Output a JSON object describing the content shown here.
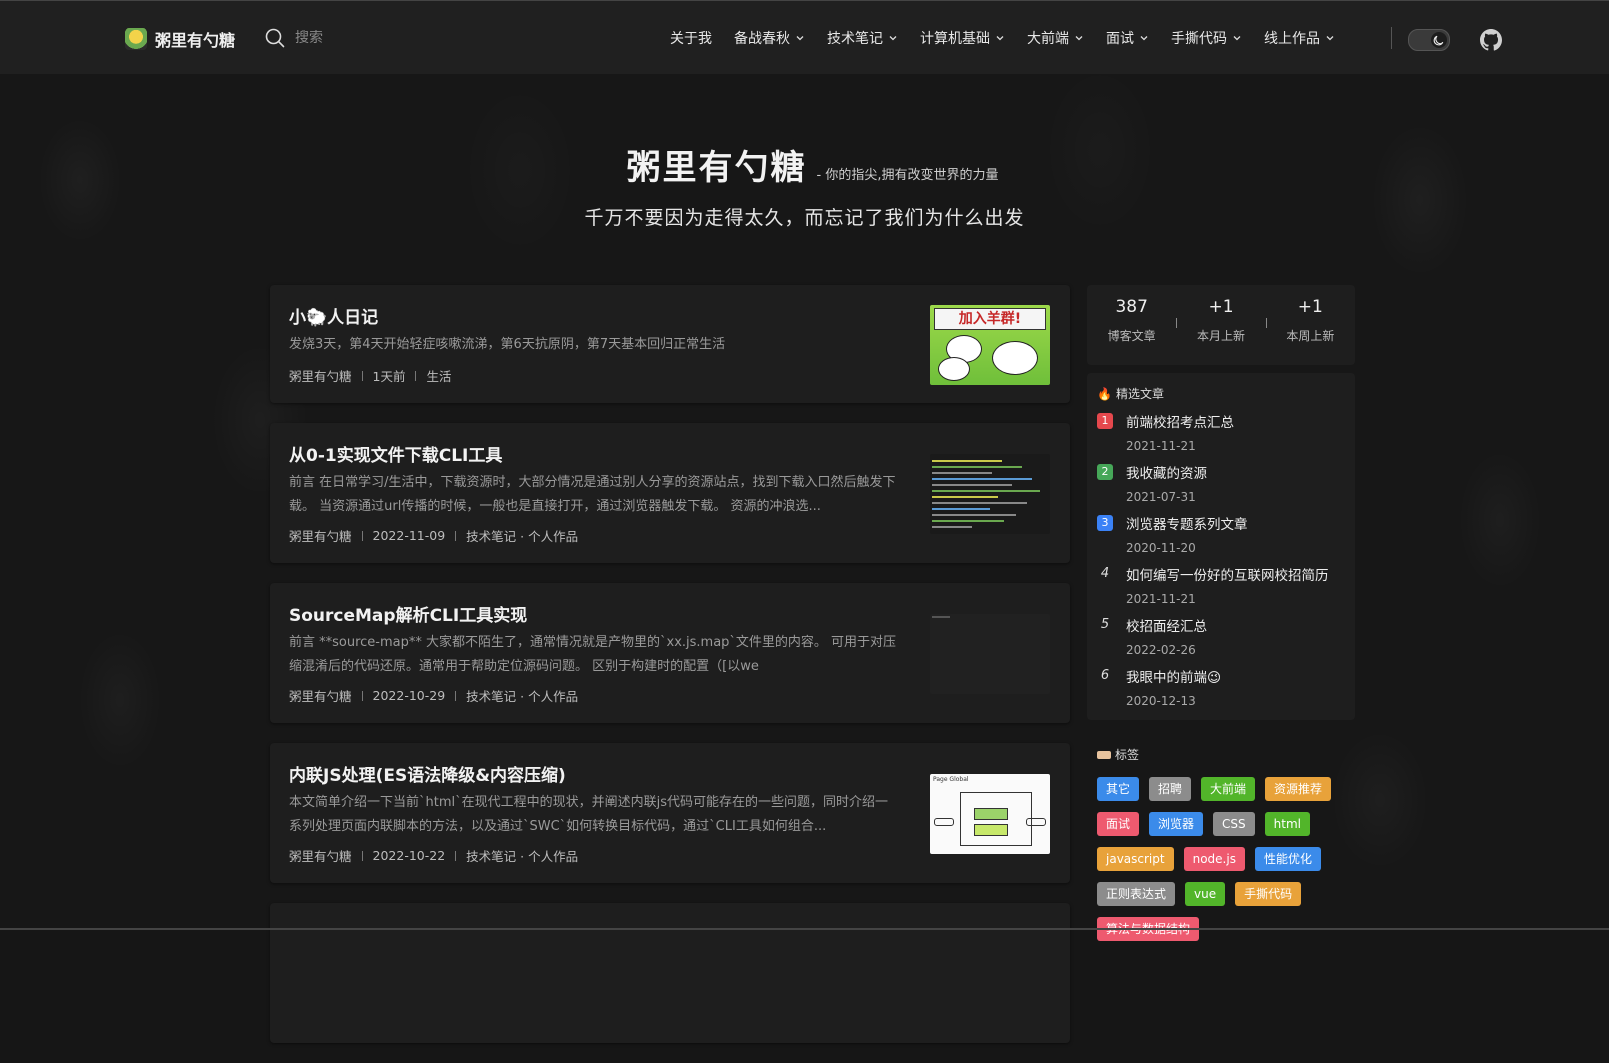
{
  "header": {
    "logo_text": "粥里有勺糖",
    "search_placeholder": "搜索",
    "nav": [
      {
        "label": "关于我",
        "dropdown": false
      },
      {
        "label": "备战春秋",
        "dropdown": true
      },
      {
        "label": "技术笔记",
        "dropdown": true
      },
      {
        "label": "计算机基础",
        "dropdown": true
      },
      {
        "label": "大前端",
        "dropdown": true
      },
      {
        "label": "面试",
        "dropdown": true
      },
      {
        "label": "手撕代码",
        "dropdown": true
      },
      {
        "label": "线上作品",
        "dropdown": true
      }
    ],
    "theme_icon": "moon-icon",
    "github_icon": "github-icon"
  },
  "hero": {
    "title": "粥里有勺糖",
    "slogan": "- 你的指尖,拥有改变世界的力量",
    "subtitle": "千万不要因为走得太久，而忘记了我们为什么出发"
  },
  "articles": [
    {
      "title": "小🐑人日记",
      "summary": "发烧3天，第4天开始轻症咳嗽流涕，第6天抗原阴，第7天基本回归正常生活",
      "author": "粥里有勺糖",
      "date": "1天前",
      "category": "生活",
      "thumb_text": "加入羊群!"
    },
    {
      "title": "从0-1实现文件下载CLI工具",
      "summary": "前言 在日常学习/生活中，下载资源时，大部分情况是通过别人分享的资源站点，找到下载入口然后触发下载。 当资源通过url传播的时候，一般也是直接打开，通过浏览器触发下载。 资源的冲浪选...",
      "author": "粥里有勺糖",
      "date": "2022-11-09",
      "category": "技术笔记 · 个人作品"
    },
    {
      "title": "SourceMap解析CLI工具实现",
      "summary": "前言 **source-map** 大家都不陌生了，通常情况就是产物里的`xx.js.map`文件里的内容。 可用于对压缩混淆后的代码还原。通常用于帮助定位源码问题。 区别于构建时的配置（[以we",
      "author": "粥里有勺糖",
      "date": "2022-10-29",
      "category": "技术笔记 · 个人作品"
    },
    {
      "title": "内联JS处理(ES语法降级&内容压缩)",
      "summary": "本文简单介绍一下当前`html`在现代工程中的现状，并阐述内联js代码可能存在的一些问题，同时介绍一系列处理页面内联脚本的方法，以及通过`SWC`如何转换目标代码，通过`CLI工具如何组合...",
      "author": "粥里有勺糖",
      "date": "2022-10-22",
      "category": "技术笔记 · 个人作品",
      "thumb_text": "Page Global"
    }
  ],
  "stats": [
    {
      "num": "387",
      "label": "博客文章"
    },
    {
      "num": "+1",
      "label": "本月上新"
    },
    {
      "num": "+1",
      "label": "本周上新"
    }
  ],
  "featured": {
    "title": "精选文章",
    "items": [
      {
        "rank": "1",
        "color": "#e5484d",
        "title": "前端校招考点汇总",
        "date": "2021-11-21"
      },
      {
        "rank": "2",
        "color": "#46a758",
        "title": "我收藏的资源",
        "date": "2021-07-31"
      },
      {
        "rank": "3",
        "color": "#3b82f6",
        "title": "浏览器专题系列文章",
        "date": "2020-11-20"
      },
      {
        "rank": "4",
        "color": "",
        "title": "如何编写一份好的互联网校招简历",
        "date": "2021-11-21"
      },
      {
        "rank": "5",
        "color": "",
        "title": "校招面经汇总",
        "date": "2022-02-26"
      },
      {
        "rank": "6",
        "color": "",
        "title": "我眼中的前端😉",
        "date": "2020-12-13"
      }
    ]
  },
  "tags": {
    "title": "标签",
    "items": [
      {
        "label": "其它",
        "color": "#3b8bea"
      },
      {
        "label": "招聘",
        "color": "#8c8c8c"
      },
      {
        "label": "大前端",
        "color": "#52b52a"
      },
      {
        "label": "资源推荐",
        "color": "#e8a23a"
      },
      {
        "label": "面试",
        "color": "#ee5a6f"
      },
      {
        "label": "浏览器",
        "color": "#3b8bea"
      },
      {
        "label": "CSS",
        "color": "#8c8c8c"
      },
      {
        "label": "html",
        "color": "#52b52a"
      },
      {
        "label": "javascript",
        "color": "#e8a23a"
      },
      {
        "label": "node.js",
        "color": "#ee5a6f"
      },
      {
        "label": "性能优化",
        "color": "#3b8bea"
      },
      {
        "label": "正则表达式",
        "color": "#8c8c8c"
      },
      {
        "label": "vue",
        "color": "#52b52a"
      },
      {
        "label": "手撕代码",
        "color": "#e8a23a"
      },
      {
        "label": "算法与数据结构",
        "color": "#ee5a6f"
      }
    ]
  }
}
